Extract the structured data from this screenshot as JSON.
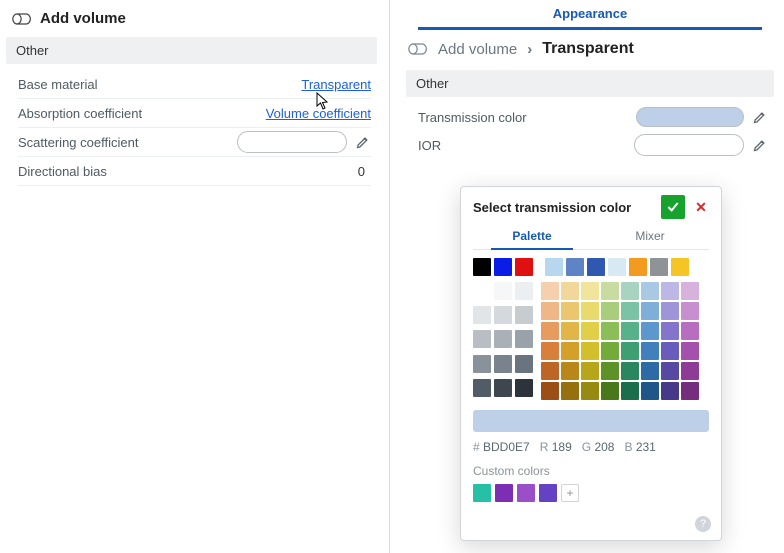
{
  "left": {
    "title": "Add volume",
    "section": "Other",
    "rows": {
      "base_material": {
        "label": "Base material",
        "link": "Transparent"
      },
      "absorption": {
        "label": "Absorption coefficient",
        "link": "Volume coefficient"
      },
      "scattering": {
        "label": "Scattering coefficient",
        "value": ""
      },
      "directional": {
        "label": "Directional bias",
        "value": "0"
      }
    }
  },
  "right": {
    "tab": "Appearance",
    "crumb_root": "Add volume",
    "crumb_sep": "›",
    "crumb_current": "Transparent",
    "section": "Other",
    "rows": {
      "transmission": {
        "label": "Transmission color",
        "swatch": "#BDD0E7"
      },
      "ior": {
        "label": "IOR",
        "value": ""
      }
    }
  },
  "popover": {
    "title": "Select transmission color",
    "tab_palette": "Palette",
    "tab_mixer": "Mixer",
    "top_row_left": [
      "#000000",
      "#0a1de6",
      "#e11010"
    ],
    "top_row_right": [
      "#b7d7ef",
      "#5f84c6",
      "#2f58b0",
      "#d7e9f2",
      "#f39b1e",
      "#8e9398",
      "#f4c524"
    ],
    "grays_grid": [
      "#ffffff",
      "#f6f7f8",
      "#eceff1",
      "#e2e5e8",
      "#d5d9dd",
      "#c7ccd1",
      "#b8bec4",
      "#a9b0b7",
      "#99a1a9",
      "#89929b",
      "#79838d",
      "#69747f",
      "#525c67",
      "#3e4750",
      "#2c333b"
    ],
    "hue_grid_start": [
      "#f6cfae",
      "#f2d79b",
      "#f0e59b",
      "#c7dca0",
      "#a8d3c0",
      "#a9c8e4",
      "#bcb7e4",
      "#d7b2dd",
      "#efb787",
      "#ebc66e",
      "#e9da6e",
      "#a9cd7a",
      "#7cc3a4",
      "#7fafd9",
      "#9e95d8",
      "#c78fcf",
      "#e89b5f",
      "#e2b548",
      "#e1cf48",
      "#8cbe57",
      "#57b28a",
      "#5c97cd",
      "#8275cb",
      "#b76dc0",
      "#d97f3c",
      "#d4a02a",
      "#d3bf2b",
      "#72ab3b",
      "#3e9f73",
      "#4180bc",
      "#6a5cba",
      "#a450ad",
      "#bd6524",
      "#b88718",
      "#b7a61a",
      "#5c9228",
      "#2a875d",
      "#2c6ba5",
      "#5748a3",
      "#8e3a97",
      "#9b4f16",
      "#97700e",
      "#968a10",
      "#49771b",
      "#1b6e49",
      "#1e568a",
      "#463989",
      "#752d7d"
    ],
    "selected_hex": "BDD0E7",
    "r_label": "R",
    "g_label": "G",
    "b_label": "B",
    "r": "189",
    "g": "208",
    "b": "231",
    "custom_title": "Custom colors",
    "custom": [
      "#25c0a5",
      "#7c2fb3",
      "#9a4fc9",
      "#6342c4"
    ]
  }
}
